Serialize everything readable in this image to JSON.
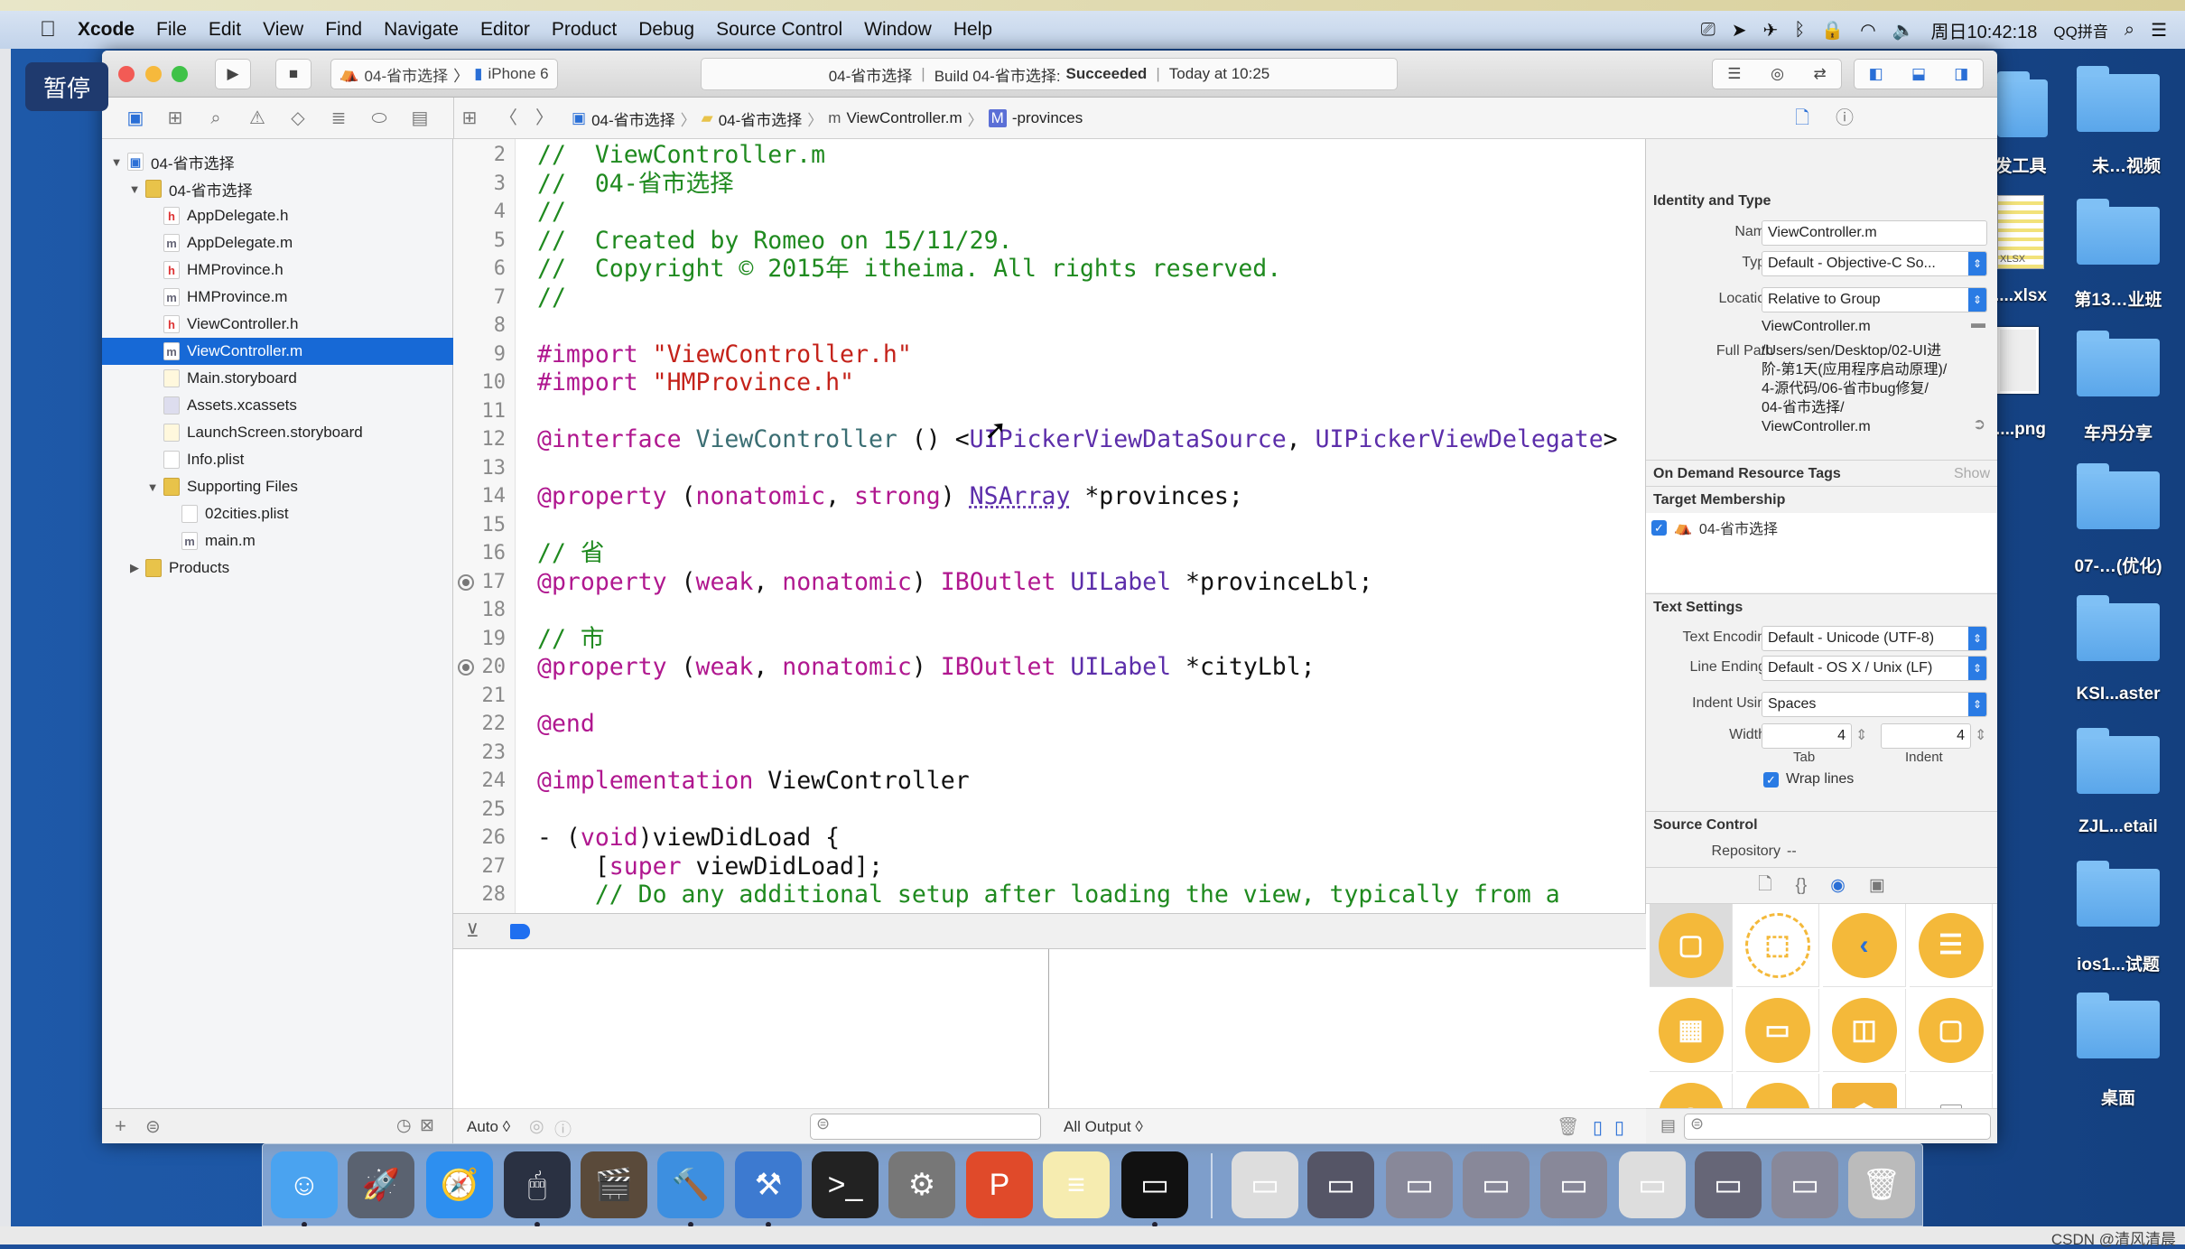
{
  "menubar": {
    "items": [
      "Xcode",
      "File",
      "Edit",
      "View",
      "Find",
      "Navigate",
      "Editor",
      "Product",
      "Debug",
      "Source Control",
      "Window",
      "Help"
    ],
    "clock": "周日10:42:18",
    "input_method": "QQ拼音"
  },
  "overlay": {
    "pause_label": "暂停"
  },
  "toolbar": {
    "scheme": "04-省市选择",
    "device": "iPhone 6",
    "activity": {
      "project": "04-省市选择",
      "build": "Build 04-省市选择:",
      "status": "Succeeded",
      "time": "Today at 10:25"
    }
  },
  "jumpbar": {
    "crumbs": [
      "04-省市选择",
      "04-省市选择",
      "ViewController.m",
      "-provinces"
    ]
  },
  "navigator": {
    "items": [
      {
        "label": "04-省市选择",
        "level": 0,
        "kind": "project",
        "disclosure": "open"
      },
      {
        "label": "04-省市选择",
        "level": 1,
        "kind": "folder",
        "disclosure": "open"
      },
      {
        "label": "AppDelegate.h",
        "level": 2,
        "kind": "h"
      },
      {
        "label": "AppDelegate.m",
        "level": 2,
        "kind": "m"
      },
      {
        "label": "HMProvince.h",
        "level": 2,
        "kind": "h"
      },
      {
        "label": "HMProvince.m",
        "level": 2,
        "kind": "m"
      },
      {
        "label": "ViewController.h",
        "level": 2,
        "kind": "h"
      },
      {
        "label": "ViewController.m",
        "level": 2,
        "kind": "m",
        "selected": true
      },
      {
        "label": "Main.storyboard",
        "level": 2,
        "kind": "sb"
      },
      {
        "label": "Assets.xcassets",
        "level": 2,
        "kind": "assets"
      },
      {
        "label": "LaunchScreen.storyboard",
        "level": 2,
        "kind": "sb"
      },
      {
        "label": "Info.plist",
        "level": 2,
        "kind": "plist"
      },
      {
        "label": "Supporting Files",
        "level": 2,
        "kind": "folder",
        "disclosure": "open"
      },
      {
        "label": "02cities.plist",
        "level": 3,
        "kind": "plist"
      },
      {
        "label": "main.m",
        "level": 3,
        "kind": "m"
      },
      {
        "label": "Products",
        "level": 1,
        "kind": "folder",
        "disclosure": "closed"
      }
    ]
  },
  "editor": {
    "lines": [
      {
        "n": 2,
        "s": [
          [
            "//  ViewController.m",
            "cm"
          ]
        ]
      },
      {
        "n": 3,
        "s": [
          [
            "//  04-省市选择",
            "cm"
          ]
        ]
      },
      {
        "n": 4,
        "s": [
          [
            "//",
            "cm"
          ]
        ]
      },
      {
        "n": 5,
        "s": [
          [
            "//  Created by Romeo on 15/11/29.",
            "cm"
          ]
        ]
      },
      {
        "n": 6,
        "s": [
          [
            "//  Copyright © 2015年 itheima. All rights reserved.",
            "cm"
          ]
        ]
      },
      {
        "n": 7,
        "s": [
          [
            "//",
            "cm"
          ]
        ]
      },
      {
        "n": 8,
        "s": []
      },
      {
        "n": 9,
        "s": [
          [
            "#import ",
            "kw"
          ],
          [
            "\"ViewController.h\"",
            "st"
          ]
        ]
      },
      {
        "n": 10,
        "s": [
          [
            "#import ",
            "kw"
          ],
          [
            "\"HMProvince.h\"",
            "st"
          ]
        ]
      },
      {
        "n": 11,
        "s": []
      },
      {
        "n": 12,
        "s": [
          [
            "@interface ",
            "kw"
          ],
          [
            "ViewController",
            "pj"
          ],
          [
            " () <",
            "pl"
          ],
          [
            "UIPickerViewDataSource",
            "sy"
          ],
          [
            ", ",
            "pl"
          ],
          [
            "UIPickerViewDelegate",
            "sy"
          ],
          [
            ">",
            "pl"
          ]
        ]
      },
      {
        "n": 13,
        "s": []
      },
      {
        "n": 14,
        "s": [
          [
            "@property ",
            "kw"
          ],
          [
            "(",
            "pl"
          ],
          [
            "nonatomic",
            "kw"
          ],
          [
            ", ",
            "pl"
          ],
          [
            "strong",
            "kw"
          ],
          [
            ") ",
            "pl"
          ],
          [
            "NSArray",
            "ul"
          ],
          [
            " *provinces;",
            "pl"
          ]
        ]
      },
      {
        "n": 15,
        "s": []
      },
      {
        "n": 16,
        "s": [
          [
            "// 省",
            "cm"
          ]
        ]
      },
      {
        "n": 17,
        "outlet": true,
        "s": [
          [
            "@property ",
            "kw"
          ],
          [
            "(",
            "pl"
          ],
          [
            "weak",
            "kw"
          ],
          [
            ", ",
            "pl"
          ],
          [
            "nonatomic",
            "kw"
          ],
          [
            ") ",
            "pl"
          ],
          [
            "IBOutlet ",
            "kw"
          ],
          [
            "UILabel",
            "sy"
          ],
          [
            " *provinceLbl;",
            "pl"
          ]
        ]
      },
      {
        "n": 18,
        "s": []
      },
      {
        "n": 19,
        "s": [
          [
            "// 市",
            "cm"
          ]
        ]
      },
      {
        "n": 20,
        "outlet": true,
        "s": [
          [
            "@property ",
            "kw"
          ],
          [
            "(",
            "pl"
          ],
          [
            "weak",
            "kw"
          ],
          [
            ", ",
            "pl"
          ],
          [
            "nonatomic",
            "kw"
          ],
          [
            ") ",
            "pl"
          ],
          [
            "IBOutlet ",
            "kw"
          ],
          [
            "UILabel",
            "sy"
          ],
          [
            " *cityLbl;",
            "pl"
          ]
        ]
      },
      {
        "n": 21,
        "s": []
      },
      {
        "n": 22,
        "s": [
          [
            "@end",
            "kw"
          ]
        ]
      },
      {
        "n": 23,
        "s": []
      },
      {
        "n": 24,
        "s": [
          [
            "@implementation ",
            "kw"
          ],
          [
            "ViewController",
            "pl"
          ]
        ]
      },
      {
        "n": 25,
        "s": []
      },
      {
        "n": 26,
        "s": [
          [
            "- (",
            "pl"
          ],
          [
            "void",
            "kw"
          ],
          [
            ")viewDidLoad {",
            "pl"
          ]
        ]
      },
      {
        "n": 27,
        "s": [
          [
            "    [",
            "pl"
          ],
          [
            "super",
            "kw"
          ],
          [
            " viewDidLoad];",
            "pl"
          ]
        ]
      },
      {
        "n": 28,
        "s": [
          [
            "    // Do any additional setup after loading the view, typically from a",
            "cm"
          ]
        ]
      }
    ]
  },
  "debug": {
    "scope": "Auto ◊",
    "output": "All Output ◊"
  },
  "inspector": {
    "identity": {
      "title": "Identity and Type",
      "name_label": "Name",
      "name": "ViewController.m",
      "type_label": "Type",
      "type": "Default - Objective-C So...",
      "location_label": "Location",
      "location": "Relative to Group",
      "relative_path": "ViewController.m",
      "full_path_label": "Full Path",
      "full_path": [
        "/Users/sen/Desktop/02-UI进",
        "阶-第1天(应用程序启动原理)/",
        "4-源代码/06-省市bug修复/",
        "04-省市选择/",
        "ViewController.m"
      ]
    },
    "odr": {
      "title": "On Demand Resource Tags",
      "show": "Show"
    },
    "target": {
      "title": "Target Membership",
      "name": "04-省市选择",
      "checked": true
    },
    "text": {
      "title": "Text Settings",
      "encoding_label": "Text Encoding",
      "encoding": "Default - Unicode (UTF-8)",
      "endings_label": "Line Endings",
      "endings": "Default - OS X / Unix (LF)",
      "indent_label": "Indent Using",
      "indent": "Spaces",
      "widths_label": "Widths",
      "tab": "4",
      "indent_width": "4",
      "tab_label": "Tab",
      "indent_width_label": "Indent",
      "wrap_label": "Wrap lines",
      "wrap": true
    },
    "sc": {
      "title": "Source Control",
      "repo_label": "Repository",
      "repo": "--"
    },
    "library": [
      "view-controller",
      "storyboard-reference",
      "navigation-controller",
      "table-view-controller",
      "collection-view-controller",
      "tab-bar-controller",
      "split-view-controller",
      "page-view-controller",
      "glkit-view-controller",
      "av-player-view-controller",
      "object",
      "label"
    ],
    "library_label_glyph": "L"
  },
  "dock": [
    "finder",
    "launchpad",
    "safari",
    "mouse-app",
    "imovie",
    "xcode",
    "xcode-beta",
    "terminal",
    "system-preferences",
    "wps",
    "notes",
    "terminal-exec",
    "window-1",
    "window-2",
    "window-3",
    "window-4",
    "window-5",
    "window-6",
    "window-7",
    "window-8",
    "trash"
  ],
  "desktop": {
    "col1": [
      "发工具",
      "....xlsx",
      "....png"
    ],
    "col2": [
      "未…视频",
      "第13…业班",
      "车丹分享",
      "07-…(优化)",
      "KSI...aster",
      "ZJL...etail",
      "ios1...试题",
      "桌面"
    ],
    "xlsx_badge": "XLSX"
  },
  "watermark": "CSDN @清风清晨"
}
